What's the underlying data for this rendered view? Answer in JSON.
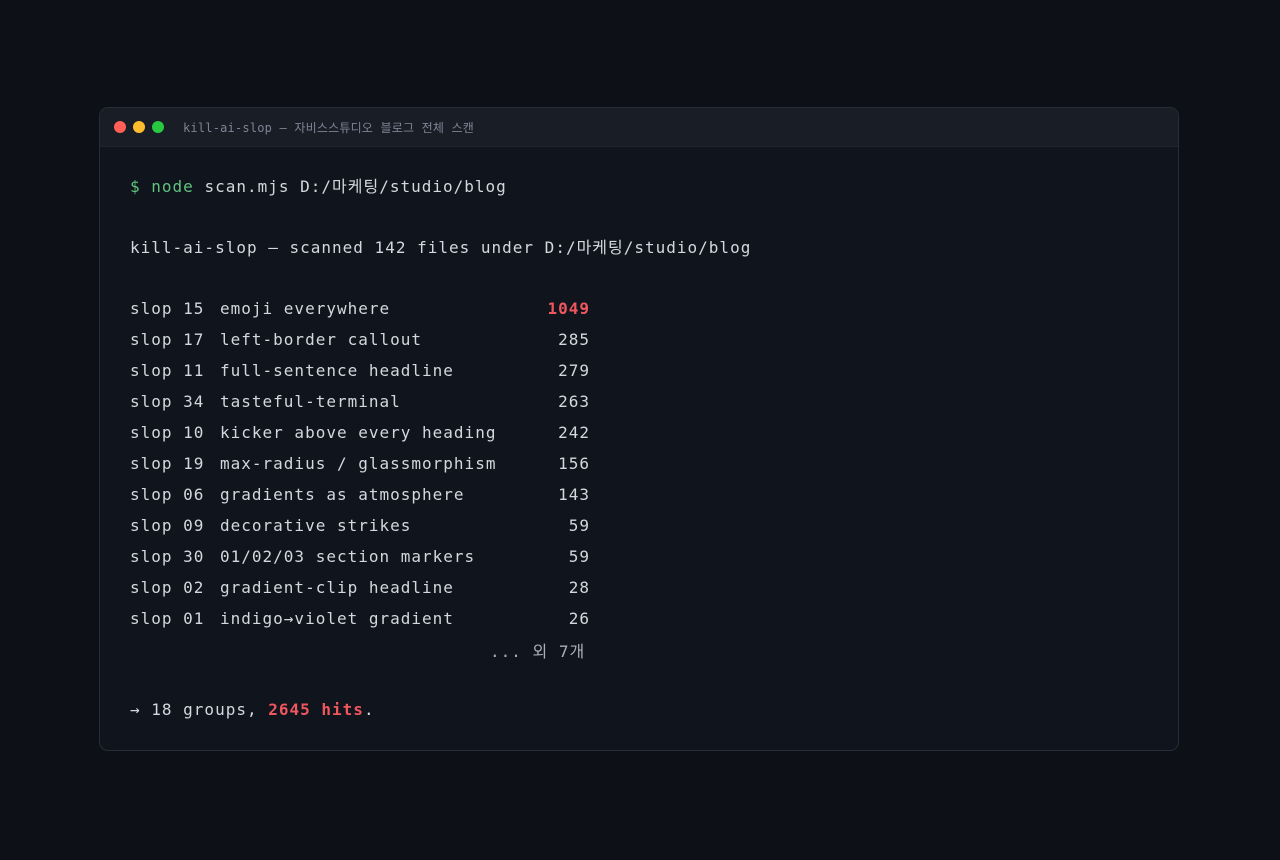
{
  "window": {
    "title": "kill-ai-slop — 자비스스튜디오 블로그 전체 스캔"
  },
  "command": {
    "prompt": "$",
    "program": "node",
    "args": "scan.mjs D:/마케팅/studio/blog"
  },
  "summary_line": "kill-ai-slop — scanned 142 files under D:/마케팅/studio/blog",
  "results": [
    {
      "id": "slop 15",
      "label": "emoji everywhere",
      "count": "1049",
      "highlight": true
    },
    {
      "id": "slop 17",
      "label": "left-border callout",
      "count": "285",
      "highlight": false
    },
    {
      "id": "slop 11",
      "label": "full-sentence headline",
      "count": "279",
      "highlight": false
    },
    {
      "id": "slop 34",
      "label": "tasteful-terminal",
      "count": "263",
      "highlight": false
    },
    {
      "id": "slop 10",
      "label": "kicker above every heading",
      "count": "242",
      "highlight": false
    },
    {
      "id": "slop 19",
      "label": "max-radius / glassmorphism",
      "count": "156",
      "highlight": false
    },
    {
      "id": "slop 06",
      "label": "gradients as atmosphere",
      "count": "143",
      "highlight": false
    },
    {
      "id": "slop 09",
      "label": "decorative strikes",
      "count": "59",
      "highlight": false
    },
    {
      "id": "slop 30",
      "label": "01/02/03 section markers",
      "count": "59",
      "highlight": false
    },
    {
      "id": "slop 02",
      "label": "gradient-clip headline",
      "count": "28",
      "highlight": false
    },
    {
      "id": "slop 01",
      "label": "indigo→violet gradient",
      "count": "26",
      "highlight": false
    }
  ],
  "more_text": "... 외 7개",
  "totals": {
    "prefix": "→ 18 groups, ",
    "hits": "2645 hits",
    "suffix": "."
  },
  "colors": {
    "background": "#0d1016",
    "terminal_bg": "#10141c",
    "prompt_green": "#5fc47e",
    "highlight_red": "#f0565e",
    "text": "#d4d7dd"
  }
}
